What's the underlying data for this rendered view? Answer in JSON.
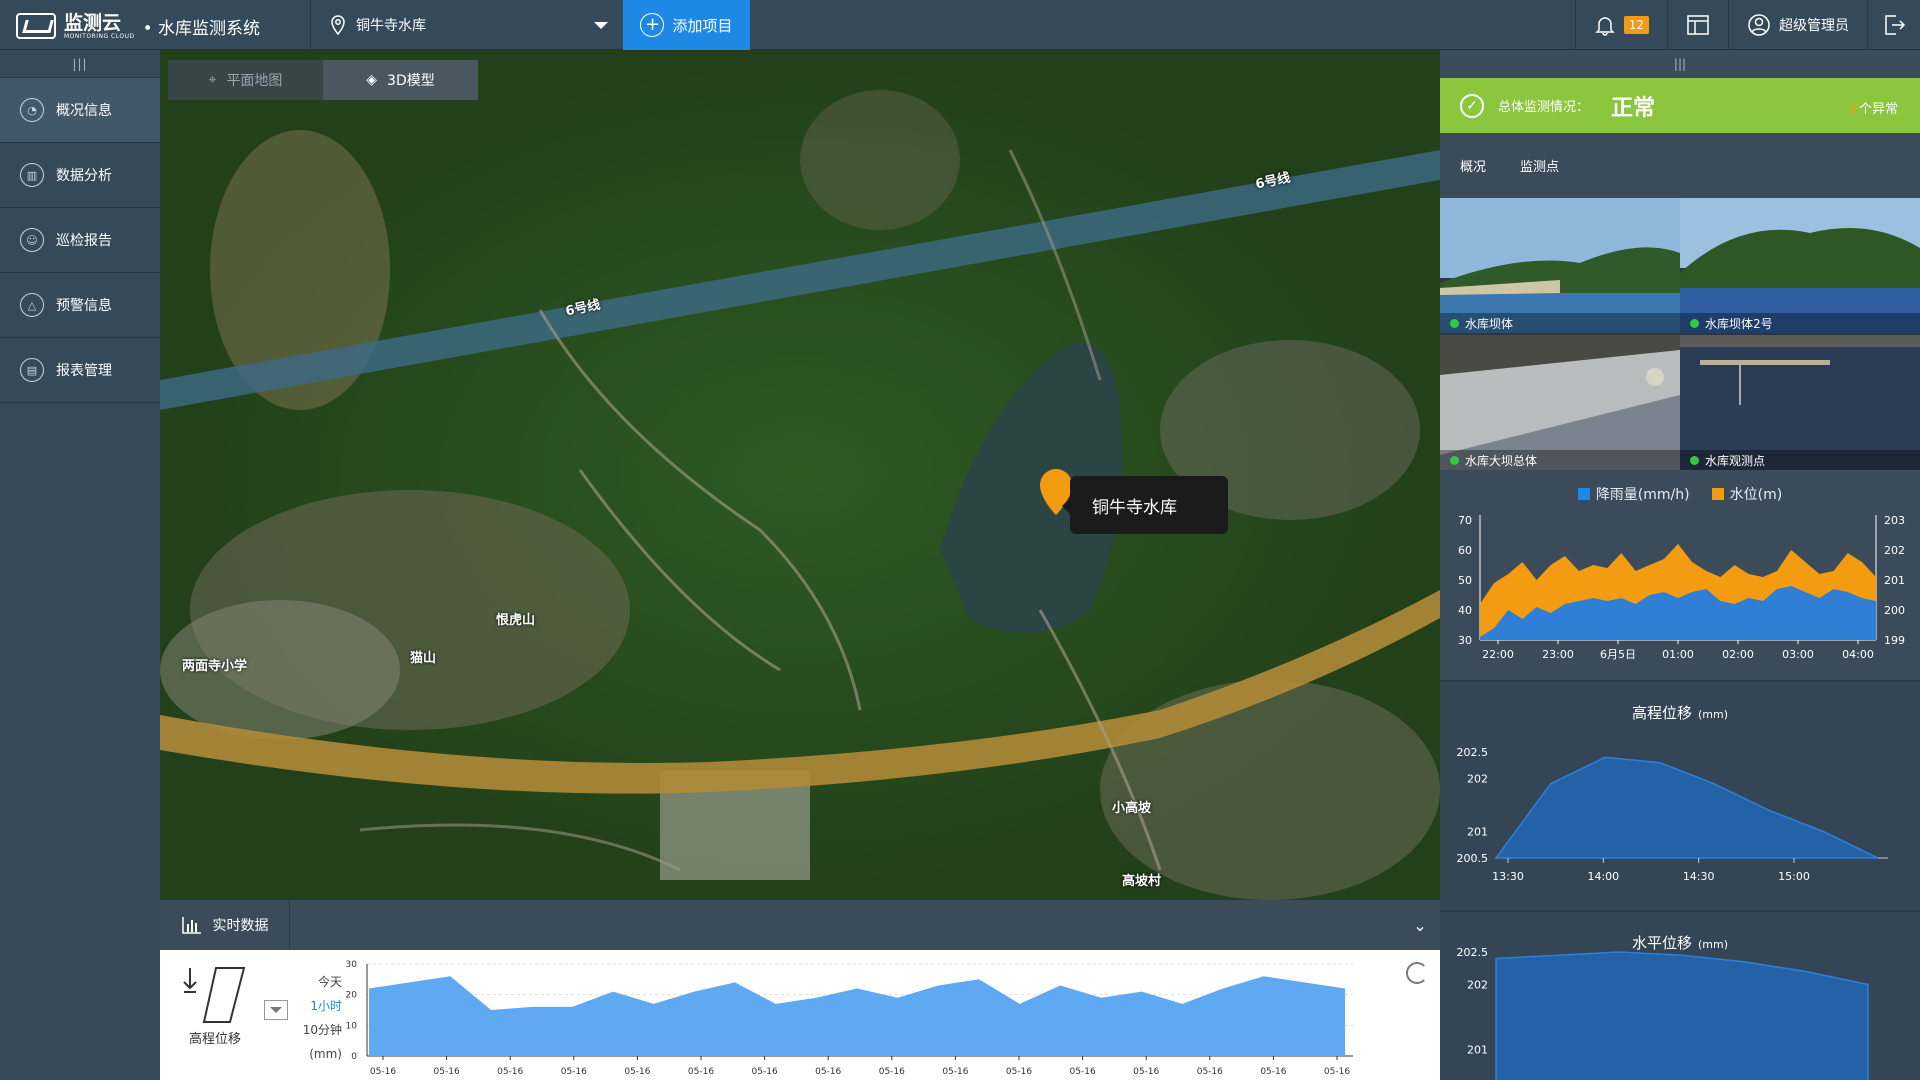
{
  "header": {
    "logo_text": "监测云",
    "logo_sub": "MONITORING CLOUD",
    "app_title": "• 水库监测系统",
    "project_name": "铜牛寺水库",
    "add_project_label": "添加项目",
    "notification_count": "12",
    "user_name": "超级管理员"
  },
  "sidebar": {
    "items": [
      {
        "label": "概况信息",
        "icon": "overview-icon"
      },
      {
        "label": "数据分析",
        "icon": "chart-icon"
      },
      {
        "label": "巡检报告",
        "icon": "inspection-icon"
      },
      {
        "label": "预警信息",
        "icon": "warning-icon"
      },
      {
        "label": "报表管理",
        "icon": "report-icon"
      }
    ]
  },
  "map": {
    "tabs": [
      {
        "label": "平面地图"
      },
      {
        "label": "3D模型"
      }
    ],
    "marker_label": "铜牛寺水库",
    "labels": {
      "metro_a": "6号线",
      "metro_b": "6号线",
      "henhu": "恨虎山",
      "mao": "猫山",
      "school": "两面寺小学",
      "xiaogao": "小高坡",
      "gaopo": "高坡村"
    }
  },
  "bottom": {
    "tab_label": "实时数据",
    "sensor_label": "高程位移",
    "ranges": [
      "今天",
      "1小时",
      "10分钟",
      "(mm)"
    ]
  },
  "right": {
    "status_label": "总体监测情况：",
    "status_value": "正常",
    "anomaly_count": "0",
    "anomaly_suffix": "个异常",
    "tabs": [
      "概况",
      "监测点"
    ],
    "thumbs": [
      {
        "label": "水库坝体"
      },
      {
        "label": "水库坝体2号"
      },
      {
        "label": "水库大坝总体"
      },
      {
        "label": "水库观测点"
      }
    ]
  },
  "colors": {
    "accent": "#1e88e5",
    "ok": "#8cc63f",
    "rain": "#1e88e5",
    "water": "#f39c12",
    "badge": "#f39c12"
  },
  "chart_data": [
    {
      "type": "area",
      "title": "",
      "series": [
        {
          "name": "降雨量(mm/h)",
          "axis": "left",
          "values": [
            30,
            31,
            42,
            40,
            43,
            41,
            44,
            44,
            45,
            44,
            45,
            43,
            46,
            47,
            50,
            47,
            48,
            45,
            44,
            47,
            45,
            49,
            50,
            48,
            46,
            49,
            48,
            47,
            45
          ]
        },
        {
          "name": "水位(m)",
          "axis": "right",
          "values": [
            200.2,
            200.9,
            201.2,
            201.6,
            201.0,
            201.5,
            201.8,
            201.3,
            201.5,
            201.4,
            201.9,
            201.3,
            201.5,
            201.7,
            202.2,
            201.6,
            201.3,
            201.1,
            201.5,
            201.2,
            201.1,
            201.3,
            202.0,
            201.6,
            201.2,
            201.3,
            201.9,
            201.6,
            201.1
          ]
        },
        {
          "name": "降雨量(mm/h)",
          "axis": "left",
          "values": [
            31,
            34,
            40,
            37,
            41,
            39,
            42,
            43,
            44,
            43,
            44,
            42,
            45,
            46,
            44,
            46,
            47,
            43,
            42,
            44,
            43,
            47,
            48,
            46,
            44,
            47,
            46,
            44,
            43
          ]
        }
      ],
      "xticks": [
        "22:00",
        "23:00",
        "6月5日",
        "01:00",
        "02:00",
        "03:00",
        "04:00"
      ],
      "yticks_left": [
        30,
        40,
        50,
        60,
        70
      ],
      "yticks_right": [
        199,
        200,
        201,
        202,
        203
      ],
      "ylim_left": [
        30,
        70
      ],
      "ylim_right": [
        199,
        203
      ]
    },
    {
      "type": "area",
      "title": "高程位移",
      "unit": "(mm)",
      "x": [
        "13:30",
        "13:45",
        "14:00",
        "14:15",
        "14:30",
        "14:45",
        "15:00",
        "15:15"
      ],
      "values": [
        200.5,
        201.9,
        202.4,
        202.3,
        201.9,
        201.4,
        201.0,
        200.5
      ],
      "xticks": [
        "13:30",
        "14:00",
        "14:30",
        "15:00"
      ],
      "yticks": [
        200.5,
        201,
        202,
        202.5
      ],
      "ylim": [
        200.5,
        202.5
      ]
    },
    {
      "type": "area",
      "title": "水平位移",
      "unit": "(mm)",
      "values": [
        202.4,
        202.45,
        202.5,
        202.45,
        202.35,
        202.2,
        202.0
      ],
      "yticks": [
        201,
        202,
        202.5
      ],
      "ylim": [
        200.5,
        202.5
      ]
    },
    {
      "type": "area",
      "title": "",
      "xticks": [
        "05-16",
        "05-16",
        "05-16",
        "05-16",
        "05-16",
        "05-16",
        "05-16",
        "05-16",
        "05-16",
        "05-16",
        "05-16",
        "05-16",
        "05-16",
        "05-16",
        "05-16",
        "05-16"
      ],
      "yticks": [
        0,
        10,
        20,
        30
      ],
      "ylim": [
        0,
        30
      ],
      "values": [
        22,
        24,
        26,
        15,
        16,
        16,
        21,
        17,
        21,
        24,
        17,
        19,
        22,
        19,
        23,
        25,
        17,
        23,
        19,
        21,
        17,
        22,
        26,
        24,
        22
      ]
    }
  ]
}
